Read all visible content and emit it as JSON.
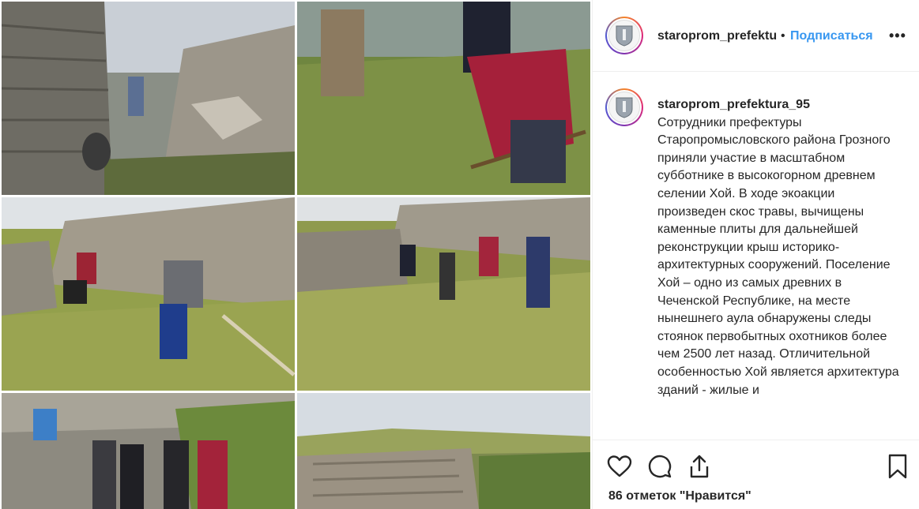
{
  "post": {
    "username_short": "staroprom_prefektu",
    "separator": "•",
    "follow_label": "Подписаться",
    "more_label": "•••"
  },
  "caption": {
    "username": "staroprom_prefektura_95",
    "text": "Сотрудники префектуры Старопромысловского района Грозного приняли участие в масштабном субботнике в высокогорном древнем селении Хой. В ходе экоакции произведен скос травы, вычищены каменные плиты для дальнейшей реконструкции крыш историко-архитектурных сооружений. Поселение Хой – одно из самых древних в Чеченской Республике, на месте нынешнего аула обнаружены следы стоянок первобытных охотников более чем 2500 лет назад. Отличительной особенностью Хой является архитектура зданий - жилые и"
  },
  "likes": {
    "text": "86 отметок \"Нравится\""
  },
  "icons": {
    "like": "heart-icon",
    "comment": "comment-icon",
    "share": "share-icon",
    "save": "bookmark-icon"
  },
  "colors": {
    "accent": "#3897f0",
    "text": "#262626",
    "border": "#efefef"
  }
}
